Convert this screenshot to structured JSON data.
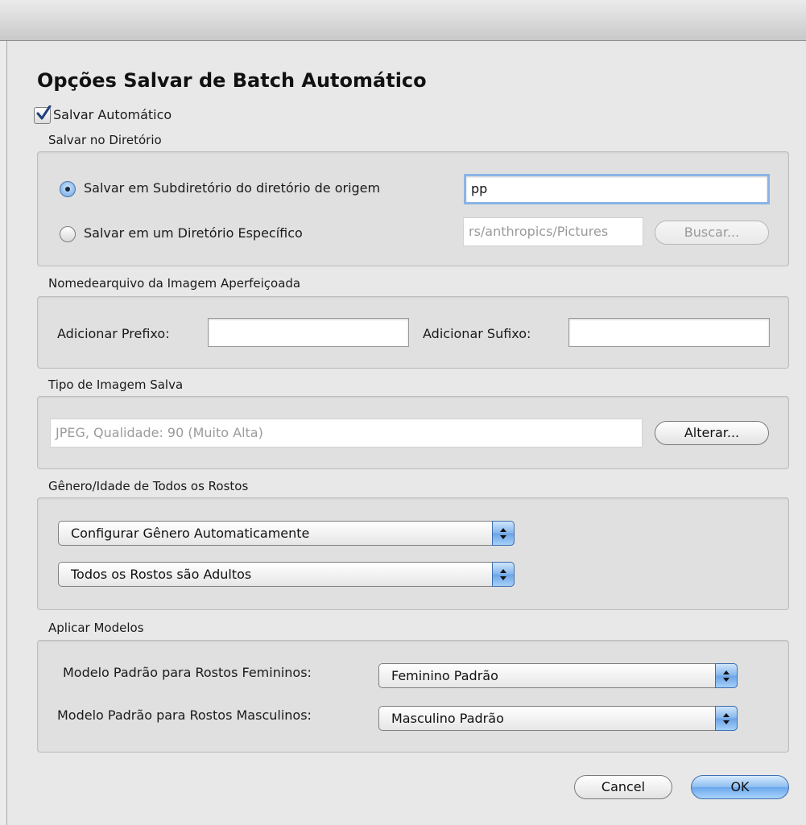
{
  "dialog": {
    "title": "Opções Salvar de Batch Automático",
    "auto_save_label": "Salvar Automático",
    "auto_save_checked": true
  },
  "directory": {
    "section_label": "Salvar no Diretório",
    "option_subdir_label": "Salvar em Subdiretório do diretório de origem",
    "subdir_value": "pp",
    "option_specific_label": "Salvar em um Diretório Específico",
    "specific_path_value": "rs/anthropics/Pictures",
    "browse_label": "Buscar...",
    "selected_option": "subdirectory"
  },
  "filename": {
    "section_label": "Nomedearquivo da Imagem Aperfeiçoada",
    "prefix_label": "Adicionar Prefixo:",
    "prefix_value": "",
    "suffix_label": "Adicionar Sufixo:",
    "suffix_value": ""
  },
  "image_type": {
    "section_label": "Tipo de Imagem Salva",
    "value": "JPEG, Qualidade: 90 (Muito Alta)",
    "change_label": "Alterar..."
  },
  "gender_age": {
    "section_label": "Gênero/Idade de Todos os Rostos",
    "gender_selected": "Configurar Gênero Automaticamente",
    "age_selected": "Todos os Rostos são Adultos"
  },
  "templates": {
    "section_label": "Aplicar Modelos",
    "female_label": "Modelo Padrão para Rostos Femininos:",
    "female_selected": "Feminino Padrão",
    "male_label": "Modelo Padrão para Rostos Masculinos:",
    "male_selected": "Masculino Padrão"
  },
  "buttons": {
    "cancel_label": "Cancel",
    "ok_label": "OK"
  },
  "colors": {
    "accent": "#6aa7eb",
    "focus_ring": "#8ab4e6"
  }
}
